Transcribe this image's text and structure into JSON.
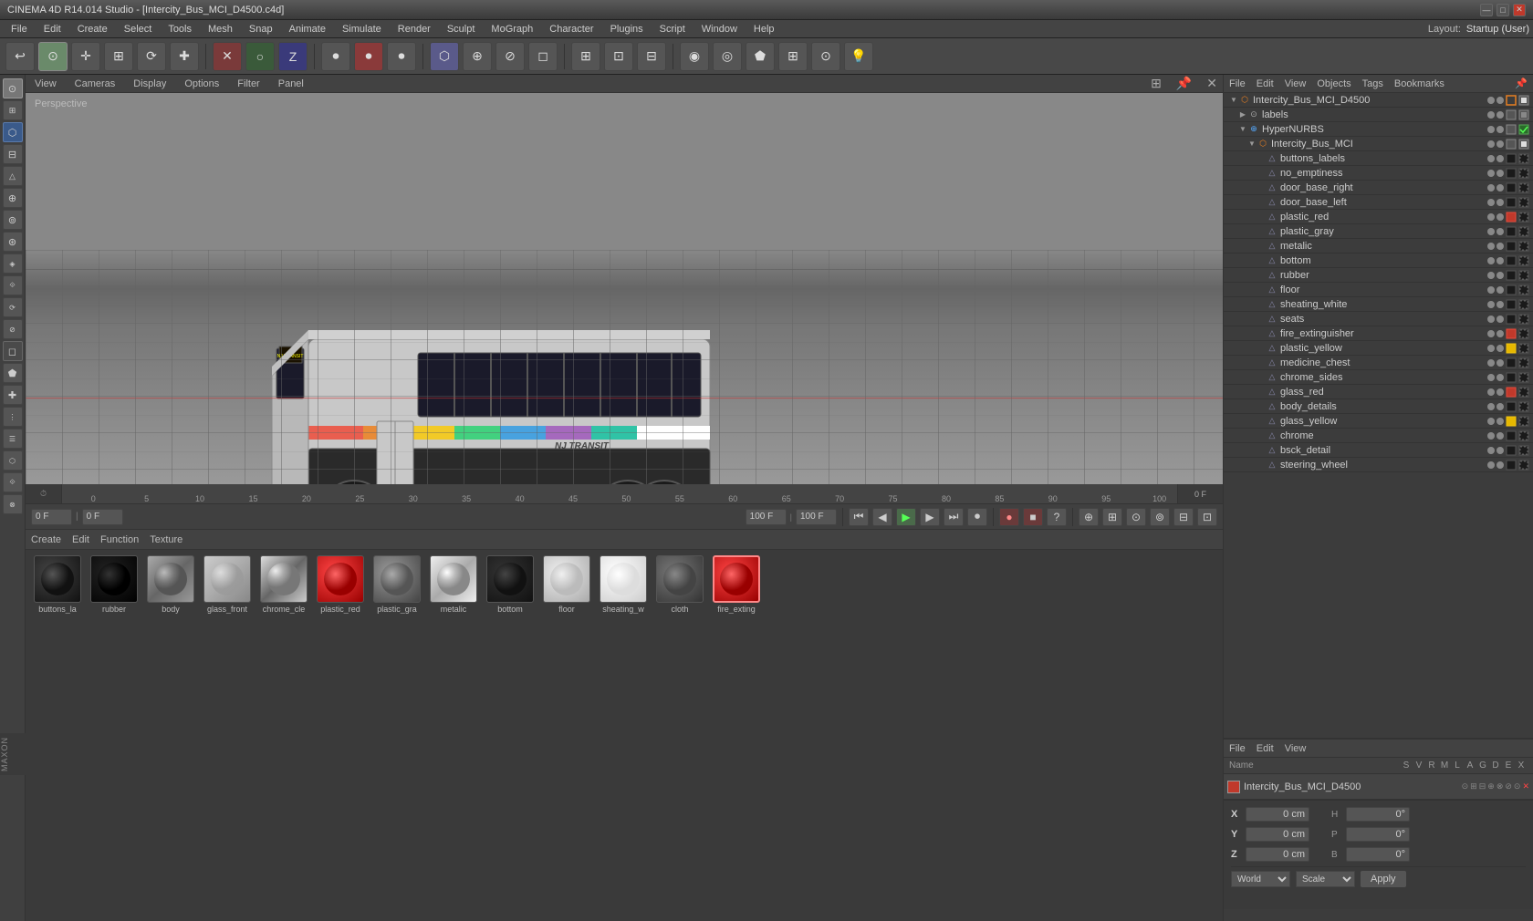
{
  "titlebar": {
    "title": "CINEMA 4D R14.014 Studio - [Intercity_Bus_MCI_D4500.c4d]",
    "controls": [
      "minimize",
      "maximize",
      "close"
    ]
  },
  "menubar": {
    "items": [
      "File",
      "Edit",
      "Create",
      "Select",
      "Tools",
      "Mesh",
      "Snap",
      "Animate",
      "Simulate",
      "Render",
      "Sculpt",
      "MoGraph",
      "Character",
      "Plugins",
      "Script",
      "Window",
      "Help"
    ]
  },
  "layout": {
    "label": "Layout:",
    "value": "Startup (User)"
  },
  "viewport": {
    "label": "Perspective",
    "menus": [
      "View",
      "Cameras",
      "Display",
      "Options",
      "Filter",
      "Panel"
    ]
  },
  "objectManager": {
    "menus": [
      "File",
      "Edit",
      "View",
      "Objects",
      "Tags",
      "Bookmarks"
    ],
    "tree": [
      {
        "id": "root",
        "label": "Intercity_Bus_MCI_D4500",
        "level": 0,
        "expanded": true,
        "icon": "null-obj",
        "color": "orange"
      },
      {
        "id": "labels",
        "label": "labels",
        "level": 1,
        "expanded": false,
        "icon": "null-obj"
      },
      {
        "id": "hypernurbs",
        "label": "HyperNURBS",
        "level": 1,
        "expanded": true,
        "icon": "hypernurbs",
        "checked": true
      },
      {
        "id": "intercity_bus_mci",
        "label": "Intercity_Bus_MCI",
        "level": 2,
        "expanded": true,
        "icon": "null-obj",
        "color": "orange"
      },
      {
        "id": "buttons_labels",
        "label": "buttons_labels",
        "level": 3,
        "icon": "mesh"
      },
      {
        "id": "no_emptiness",
        "label": "no_emptiness",
        "level": 3,
        "icon": "mesh"
      },
      {
        "id": "door_base_right",
        "label": "door_base_right",
        "level": 3,
        "icon": "mesh"
      },
      {
        "id": "door_base_left",
        "label": "door_base_left",
        "level": 3,
        "icon": "mesh"
      },
      {
        "id": "plastic_red",
        "label": "plastic_red",
        "level": 3,
        "icon": "mesh"
      },
      {
        "id": "plastic_gray",
        "label": "plastic_gray",
        "level": 3,
        "icon": "mesh"
      },
      {
        "id": "metalic",
        "label": "metalic",
        "level": 3,
        "icon": "mesh"
      },
      {
        "id": "bottom",
        "label": "bottom",
        "level": 3,
        "icon": "mesh"
      },
      {
        "id": "rubber",
        "label": "rubber",
        "level": 3,
        "icon": "mesh"
      },
      {
        "id": "floor",
        "label": "floor",
        "level": 3,
        "icon": "mesh"
      },
      {
        "id": "sheating_white",
        "label": "sheating_white",
        "level": 3,
        "icon": "mesh"
      },
      {
        "id": "seats",
        "label": "seats",
        "level": 3,
        "icon": "mesh"
      },
      {
        "id": "fire_extinguisher",
        "label": "fire_extinguisher",
        "level": 3,
        "icon": "mesh"
      },
      {
        "id": "plastic_yellow",
        "label": "plastic_yellow",
        "level": 3,
        "icon": "mesh"
      },
      {
        "id": "medicine_chest",
        "label": "medicine_chest",
        "level": 3,
        "icon": "mesh"
      },
      {
        "id": "chrome_sides",
        "label": "chrome_sides",
        "level": 3,
        "icon": "mesh"
      },
      {
        "id": "glass_red",
        "label": "glass_red",
        "level": 3,
        "icon": "mesh"
      },
      {
        "id": "body_details",
        "label": "body_details",
        "level": 3,
        "icon": "mesh"
      },
      {
        "id": "glass_yellow",
        "label": "glass_yellow",
        "level": 3,
        "icon": "mesh"
      },
      {
        "id": "chrome",
        "label": "chrome",
        "level": 3,
        "icon": "mesh"
      },
      {
        "id": "bsck_detail",
        "label": "bsck_detail",
        "level": 3,
        "icon": "mesh"
      },
      {
        "id": "steering_wheel",
        "label": "steering_wheel",
        "level": 3,
        "icon": "mesh"
      }
    ]
  },
  "attrManager": {
    "menus": [
      "File",
      "Edit",
      "View"
    ],
    "columns": [
      "Name",
      "S",
      "V",
      "R",
      "M",
      "L",
      "A",
      "G",
      "D",
      "E",
      "X"
    ],
    "selected": {
      "name": "Intercity_Bus_MCI_D4500",
      "color": "orange"
    }
  },
  "coordinates": {
    "x": {
      "pos": "0 cm",
      "size": "H",
      "size_val": "0°"
    },
    "y": {
      "pos": "0 cm",
      "size": "P",
      "size_val": "0°"
    },
    "z": {
      "pos": "0 cm",
      "size": "B",
      "size_val": "0°"
    },
    "mode": "World",
    "scale": "Scale",
    "apply_label": "Apply"
  },
  "timeline": {
    "current_frame": "0 F",
    "start_frame": "0 F",
    "end_frame": "100 F",
    "fps": "100 F",
    "marks": [
      "0",
      "5",
      "10",
      "15",
      "20",
      "25",
      "30",
      "35",
      "40",
      "45",
      "50",
      "55",
      "60",
      "65",
      "70",
      "75",
      "80",
      "85",
      "90",
      "95",
      "100"
    ],
    "right_frame": "0 F"
  },
  "materials": {
    "menus": [
      "Create",
      "Edit",
      "Function",
      "Texture"
    ],
    "items": [
      {
        "id": "buttons_la",
        "label": "buttons_la",
        "color": "#222",
        "type": "dark"
      },
      {
        "id": "rubber",
        "label": "rubber",
        "color": "#111",
        "type": "very-dark"
      },
      {
        "id": "body",
        "label": "body",
        "color": "#999",
        "type": "metal"
      },
      {
        "id": "glass_front",
        "label": "glass_front",
        "color": "#ccc",
        "type": "glass"
      },
      {
        "id": "chrome_cle",
        "label": "chrome_cle",
        "color": "#aaa",
        "type": "chrome"
      },
      {
        "id": "plastic_red",
        "label": "plastic_red",
        "color": "#c0392b",
        "type": "red"
      },
      {
        "id": "plastic_gra",
        "label": "plastic_gra",
        "color": "#888",
        "type": "gray"
      },
      {
        "id": "metalic",
        "label": "metalic",
        "color": "#bbb",
        "type": "silver"
      },
      {
        "id": "bottom",
        "label": "bottom",
        "color": "#222",
        "type": "dark"
      },
      {
        "id": "floor",
        "label": "floor",
        "color": "#ddd",
        "type": "light"
      },
      {
        "id": "sheating_w",
        "label": "sheating_w",
        "color": "#eee",
        "type": "white"
      },
      {
        "id": "cloth",
        "label": "cloth",
        "color": "#555",
        "type": "cloth"
      },
      {
        "id": "fire_exting",
        "label": "fire_exting",
        "color": "#c0392b",
        "type": "red-sphere"
      }
    ]
  },
  "lefttools": {
    "tools": [
      "⬡",
      "⊕",
      "⊞",
      "⟳",
      "✛",
      "✕",
      "○",
      "⊙",
      "⊚",
      "△",
      "◻",
      "◈",
      "◉",
      "⬟",
      "⊘",
      "⋮",
      "☰",
      "⬡",
      "⟐",
      "⊗"
    ]
  }
}
